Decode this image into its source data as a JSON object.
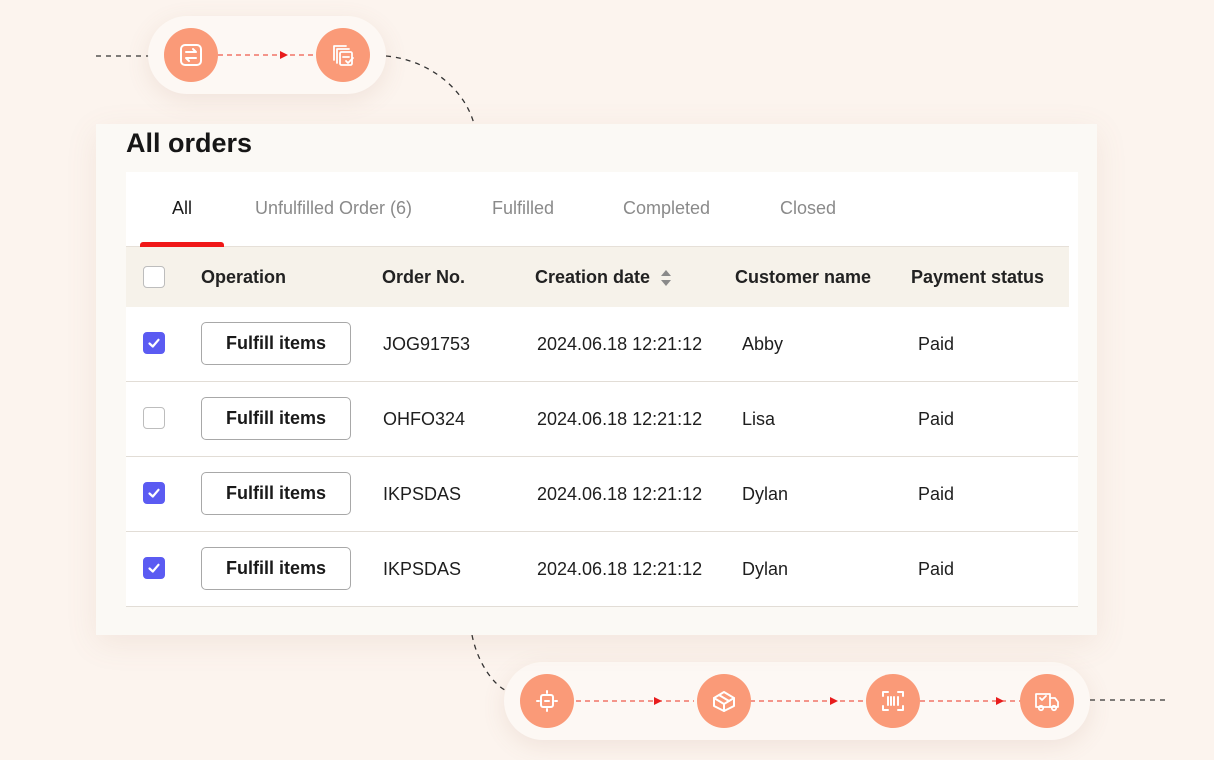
{
  "card": {
    "title": "All orders"
  },
  "tabs": [
    {
      "label": "All",
      "active": true
    },
    {
      "label": "Unfulfilled Order (6)",
      "active": false
    },
    {
      "label": "Fulfilled",
      "active": false
    },
    {
      "label": "Completed",
      "active": false
    },
    {
      "label": "Closed",
      "active": false
    }
  ],
  "columns": {
    "operation": "Operation",
    "order_no": "Order No.",
    "creation_date": "Creation date",
    "customer_name": "Customer name",
    "payment_status": "Payment status"
  },
  "rows": [
    {
      "checked": true,
      "action": "Fulfill items",
      "order_no": "JOG91753",
      "date": "2024.06.18 12:21:12",
      "customer": "Abby",
      "payment": "Paid"
    },
    {
      "checked": false,
      "action": "Fulfill items",
      "order_no": "OHFO324",
      "date": "2024.06.18 12:21:12",
      "customer": "Lisa",
      "payment": "Paid"
    },
    {
      "checked": true,
      "action": "Fulfill items",
      "order_no": "IKPSDAS",
      "date": "2024.06.18 12:21:12",
      "customer": "Dylan",
      "payment": "Paid"
    },
    {
      "checked": true,
      "action": "Fulfill items",
      "order_no": "IKPSDAS",
      "date": "2024.06.18 12:21:12",
      "customer": "Dylan",
      "payment": "Paid"
    }
  ],
  "icons": {
    "top_flow": [
      "order-transfer-icon",
      "document-check-icon"
    ],
    "bottom_flow": [
      "scan-icon",
      "package-icon",
      "barcode-icon",
      "delivery-truck-icon"
    ]
  },
  "colors": {
    "accent": "#fa9a78",
    "checkbox": "#5b5bf2",
    "tab_indicator": "#f01818",
    "background": "#fcf4ee"
  }
}
